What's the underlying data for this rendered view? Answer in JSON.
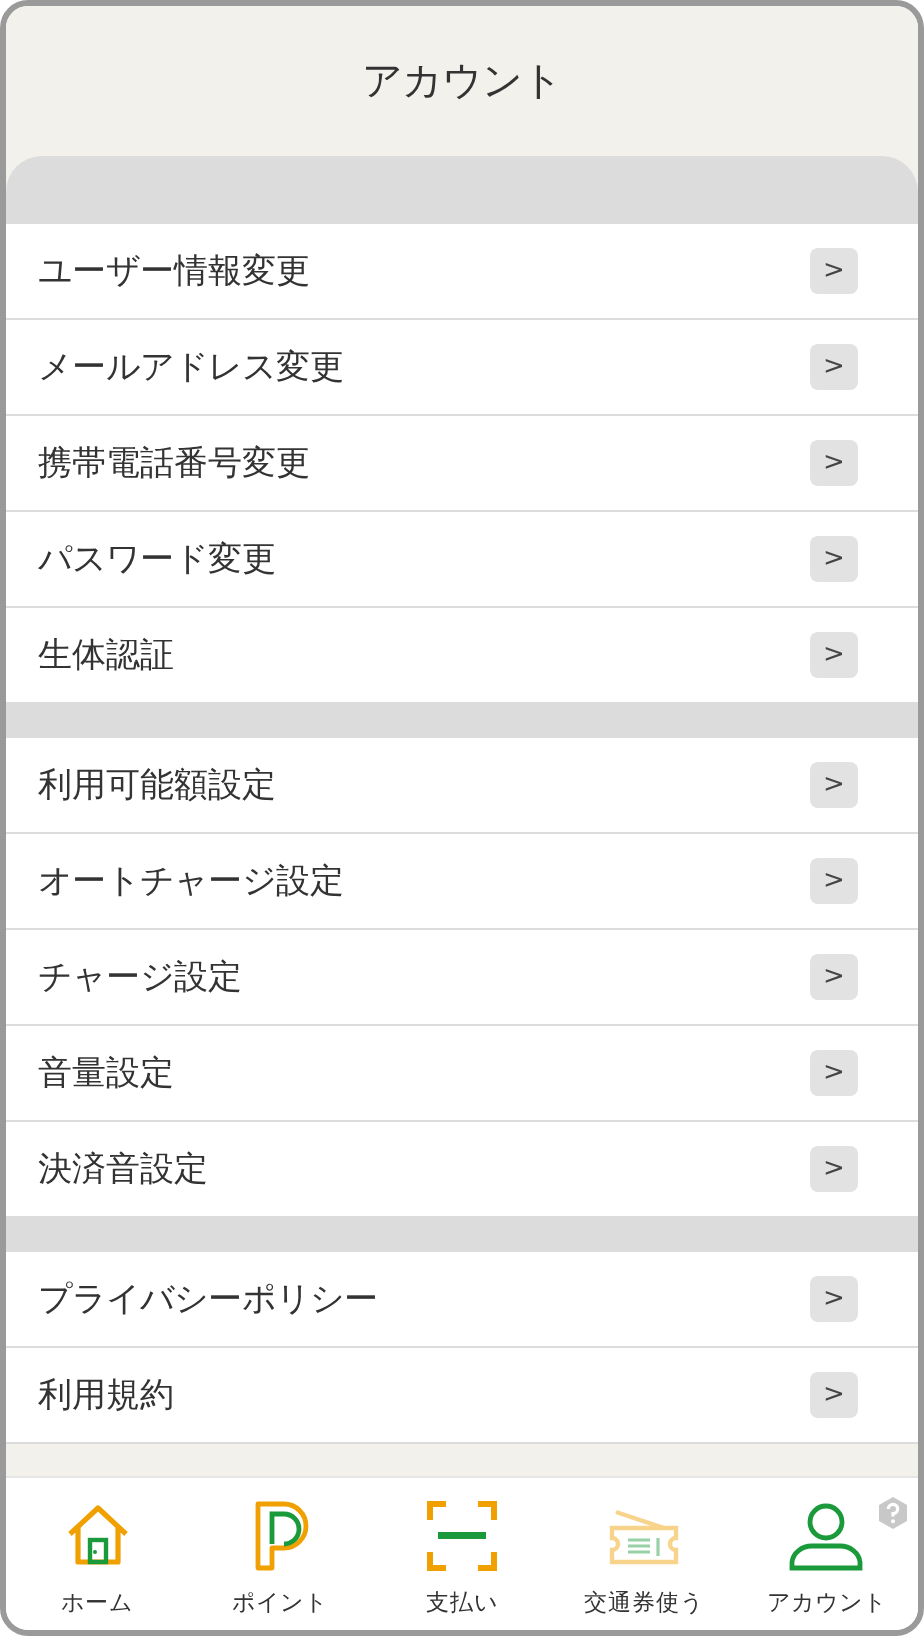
{
  "header": {
    "title": "アカウント"
  },
  "sections": [
    {
      "items": [
        "ユーザー情報変更",
        "メールアドレス変更",
        "携帯電話番号変更",
        "パスワード変更",
        "生体認証"
      ]
    },
    {
      "items": [
        "利用可能額設定",
        "オートチャージ設定",
        "チャージ設定",
        "音量設定",
        "決済音設定"
      ]
    },
    {
      "items": [
        "プライバシーポリシー",
        "利用規約"
      ]
    }
  ],
  "chevron": ">",
  "tab_bar": [
    {
      "label": "ホーム",
      "disabled": false
    },
    {
      "label": "ポイント",
      "disabled": false
    },
    {
      "label": "支払い",
      "disabled": false
    },
    {
      "label": "交通券使う",
      "disabled": true
    },
    {
      "label": "アカウント",
      "disabled": false
    }
  ]
}
